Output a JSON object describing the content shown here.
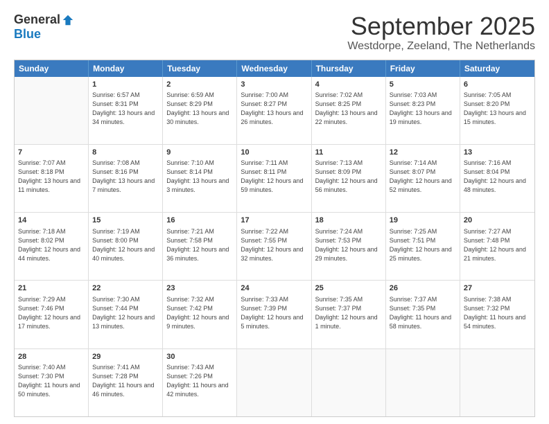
{
  "logo": {
    "general": "General",
    "blue": "Blue"
  },
  "header": {
    "month": "September 2025",
    "location": "Westdorpe, Zeeland, The Netherlands"
  },
  "days": [
    "Sunday",
    "Monday",
    "Tuesday",
    "Wednesday",
    "Thursday",
    "Friday",
    "Saturday"
  ],
  "weeks": [
    [
      {
        "day": "",
        "sunrise": "",
        "sunset": "",
        "daylight": "",
        "empty": true
      },
      {
        "day": "1",
        "sunrise": "Sunrise: 6:57 AM",
        "sunset": "Sunset: 8:31 PM",
        "daylight": "Daylight: 13 hours and 34 minutes."
      },
      {
        "day": "2",
        "sunrise": "Sunrise: 6:59 AM",
        "sunset": "Sunset: 8:29 PM",
        "daylight": "Daylight: 13 hours and 30 minutes."
      },
      {
        "day": "3",
        "sunrise": "Sunrise: 7:00 AM",
        "sunset": "Sunset: 8:27 PM",
        "daylight": "Daylight: 13 hours and 26 minutes."
      },
      {
        "day": "4",
        "sunrise": "Sunrise: 7:02 AM",
        "sunset": "Sunset: 8:25 PM",
        "daylight": "Daylight: 13 hours and 22 minutes."
      },
      {
        "day": "5",
        "sunrise": "Sunrise: 7:03 AM",
        "sunset": "Sunset: 8:23 PM",
        "daylight": "Daylight: 13 hours and 19 minutes."
      },
      {
        "day": "6",
        "sunrise": "Sunrise: 7:05 AM",
        "sunset": "Sunset: 8:20 PM",
        "daylight": "Daylight: 13 hours and 15 minutes."
      }
    ],
    [
      {
        "day": "7",
        "sunrise": "Sunrise: 7:07 AM",
        "sunset": "Sunset: 8:18 PM",
        "daylight": "Daylight: 13 hours and 11 minutes."
      },
      {
        "day": "8",
        "sunrise": "Sunrise: 7:08 AM",
        "sunset": "Sunset: 8:16 PM",
        "daylight": "Daylight: 13 hours and 7 minutes."
      },
      {
        "day": "9",
        "sunrise": "Sunrise: 7:10 AM",
        "sunset": "Sunset: 8:14 PM",
        "daylight": "Daylight: 13 hours and 3 minutes."
      },
      {
        "day": "10",
        "sunrise": "Sunrise: 7:11 AM",
        "sunset": "Sunset: 8:11 PM",
        "daylight": "Daylight: 12 hours and 59 minutes."
      },
      {
        "day": "11",
        "sunrise": "Sunrise: 7:13 AM",
        "sunset": "Sunset: 8:09 PM",
        "daylight": "Daylight: 12 hours and 56 minutes."
      },
      {
        "day": "12",
        "sunrise": "Sunrise: 7:14 AM",
        "sunset": "Sunset: 8:07 PM",
        "daylight": "Daylight: 12 hours and 52 minutes."
      },
      {
        "day": "13",
        "sunrise": "Sunrise: 7:16 AM",
        "sunset": "Sunset: 8:04 PM",
        "daylight": "Daylight: 12 hours and 48 minutes."
      }
    ],
    [
      {
        "day": "14",
        "sunrise": "Sunrise: 7:18 AM",
        "sunset": "Sunset: 8:02 PM",
        "daylight": "Daylight: 12 hours and 44 minutes."
      },
      {
        "day": "15",
        "sunrise": "Sunrise: 7:19 AM",
        "sunset": "Sunset: 8:00 PM",
        "daylight": "Daylight: 12 hours and 40 minutes."
      },
      {
        "day": "16",
        "sunrise": "Sunrise: 7:21 AM",
        "sunset": "Sunset: 7:58 PM",
        "daylight": "Daylight: 12 hours and 36 minutes."
      },
      {
        "day": "17",
        "sunrise": "Sunrise: 7:22 AM",
        "sunset": "Sunset: 7:55 PM",
        "daylight": "Daylight: 12 hours and 32 minutes."
      },
      {
        "day": "18",
        "sunrise": "Sunrise: 7:24 AM",
        "sunset": "Sunset: 7:53 PM",
        "daylight": "Daylight: 12 hours and 29 minutes."
      },
      {
        "day": "19",
        "sunrise": "Sunrise: 7:25 AM",
        "sunset": "Sunset: 7:51 PM",
        "daylight": "Daylight: 12 hours and 25 minutes."
      },
      {
        "day": "20",
        "sunrise": "Sunrise: 7:27 AM",
        "sunset": "Sunset: 7:48 PM",
        "daylight": "Daylight: 12 hours and 21 minutes."
      }
    ],
    [
      {
        "day": "21",
        "sunrise": "Sunrise: 7:29 AM",
        "sunset": "Sunset: 7:46 PM",
        "daylight": "Daylight: 12 hours and 17 minutes."
      },
      {
        "day": "22",
        "sunrise": "Sunrise: 7:30 AM",
        "sunset": "Sunset: 7:44 PM",
        "daylight": "Daylight: 12 hours and 13 minutes."
      },
      {
        "day": "23",
        "sunrise": "Sunrise: 7:32 AM",
        "sunset": "Sunset: 7:42 PM",
        "daylight": "Daylight: 12 hours and 9 minutes."
      },
      {
        "day": "24",
        "sunrise": "Sunrise: 7:33 AM",
        "sunset": "Sunset: 7:39 PM",
        "daylight": "Daylight: 12 hours and 5 minutes."
      },
      {
        "day": "25",
        "sunrise": "Sunrise: 7:35 AM",
        "sunset": "Sunset: 7:37 PM",
        "daylight": "Daylight: 12 hours and 1 minute."
      },
      {
        "day": "26",
        "sunrise": "Sunrise: 7:37 AM",
        "sunset": "Sunset: 7:35 PM",
        "daylight": "Daylight: 11 hours and 58 minutes."
      },
      {
        "day": "27",
        "sunrise": "Sunrise: 7:38 AM",
        "sunset": "Sunset: 7:32 PM",
        "daylight": "Daylight: 11 hours and 54 minutes."
      }
    ],
    [
      {
        "day": "28",
        "sunrise": "Sunrise: 7:40 AM",
        "sunset": "Sunset: 7:30 PM",
        "daylight": "Daylight: 11 hours and 50 minutes."
      },
      {
        "day": "29",
        "sunrise": "Sunrise: 7:41 AM",
        "sunset": "Sunset: 7:28 PM",
        "daylight": "Daylight: 11 hours and 46 minutes."
      },
      {
        "day": "30",
        "sunrise": "Sunrise: 7:43 AM",
        "sunset": "Sunset: 7:26 PM",
        "daylight": "Daylight: 11 hours and 42 minutes."
      },
      {
        "day": "",
        "sunrise": "",
        "sunset": "",
        "daylight": "",
        "empty": true
      },
      {
        "day": "",
        "sunrise": "",
        "sunset": "",
        "daylight": "",
        "empty": true
      },
      {
        "day": "",
        "sunrise": "",
        "sunset": "",
        "daylight": "",
        "empty": true
      },
      {
        "day": "",
        "sunrise": "",
        "sunset": "",
        "daylight": "",
        "empty": true
      }
    ]
  ]
}
